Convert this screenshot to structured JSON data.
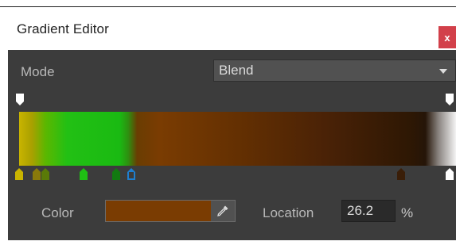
{
  "window": {
    "title": "Gradient Editor",
    "close_label": "x"
  },
  "mode": {
    "label": "Mode",
    "value": "Blend"
  },
  "alpha_keys": [
    {
      "color": "#ffffff"
    },
    {
      "color": "#ffffff"
    }
  ],
  "color_keys": [
    {
      "color": "#c9b400",
      "selected": false
    },
    {
      "color": "#8a7a0a",
      "selected": false
    },
    {
      "color": "#5a7a08",
      "selected": false
    },
    {
      "color": "#1fbf14",
      "selected": false
    },
    {
      "color": "#127a10",
      "selected": false
    },
    {
      "color": "#7a3c02",
      "selected": true
    },
    {
      "color": "#3a1e08",
      "selected": false
    },
    {
      "color": "#ffffff",
      "selected": false
    }
  ],
  "color_field": {
    "label": "Color",
    "value": "#7a3c02",
    "picker_icon": "eyedropper-icon"
  },
  "location": {
    "label": "Location",
    "value": "26.2",
    "unit": "%"
  },
  "colors": {
    "panel": "#3c3c3c",
    "close": "#d2404a",
    "selection": "#1e7fd0"
  }
}
